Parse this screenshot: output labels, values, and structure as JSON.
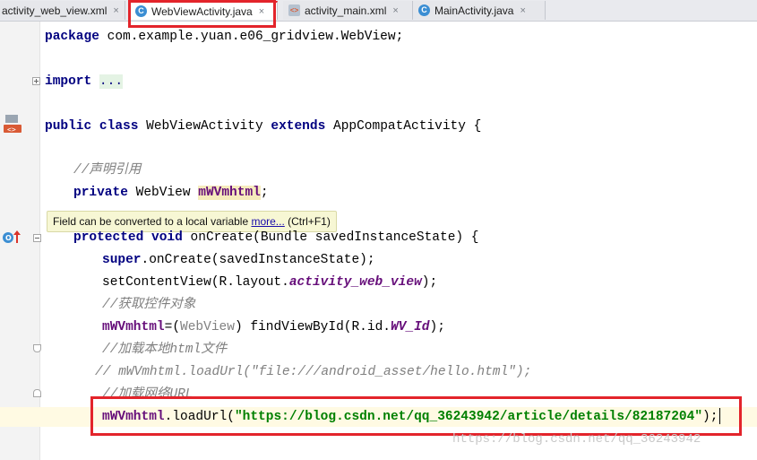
{
  "tabs": [
    {
      "label": "activity_web_view.xml",
      "icon": "xml-file-icon",
      "active": false
    },
    {
      "label": "WebViewActivity.java",
      "icon": "java-class-icon",
      "active": true
    },
    {
      "label": "activity_main.xml",
      "icon": "xml-file-icon",
      "active": false
    },
    {
      "label": "MainActivity.java",
      "icon": "java-class-icon",
      "active": false
    }
  ],
  "tab_close_glyph": "×",
  "class_icon_letter": "C",
  "code": {
    "kw_package": "package",
    "package_name": " com.example.yuan.e06_gridview.WebView;",
    "kw_import": "import",
    "import_dots": "...",
    "kw_public": "public",
    "kw_class": "class",
    "class_name": " WebViewActivity ",
    "kw_extends": "extends",
    "super_class": " AppCompatActivity {",
    "comment_declare": "//声明引用",
    "kw_private": "private",
    "field_type": " WebView ",
    "field_name": "mWVmhtml",
    "semicolon": ";",
    "kw_protected": "protected",
    "kw_void": "void",
    "on_create_sig": " onCreate(Bundle savedInstanceState) {",
    "kw_super": "super",
    "super_call": ".onCreate(savedInstanceState);",
    "set_content_pre": "setContentView(R.layout.",
    "layout_id": "activity_web_view",
    "close_paren_semi": ");",
    "comment_get_control": "//获取控件对象",
    "assign_cast_open": "=(",
    "cast_type": "WebView",
    "find_view_pre": ") findViewById(R.id.",
    "view_id": "WV_Id",
    "comment_load_local": "//加载本地html文件",
    "commented_load": "// mWVmhtml.loadUrl(\"file:///android_asset/hello.html\");",
    "comment_load_url": "//加载网络URL",
    "load_url_pre": ".loadUrl(",
    "url_string": "\"https://blog.csdn.net/qq_36243942/article/details/82187204\""
  },
  "tooltip": {
    "text": "Field can be converted to a local variable ",
    "link": "more...",
    "shortcut": " (Ctrl+F1)"
  },
  "watermark": "https://blog.csdn.net/qq_36243942",
  "colors": {
    "keyword": "#000080",
    "field": "#660e7a",
    "string": "#008000",
    "comment": "#808080",
    "highlight_box": "#e3242b"
  }
}
